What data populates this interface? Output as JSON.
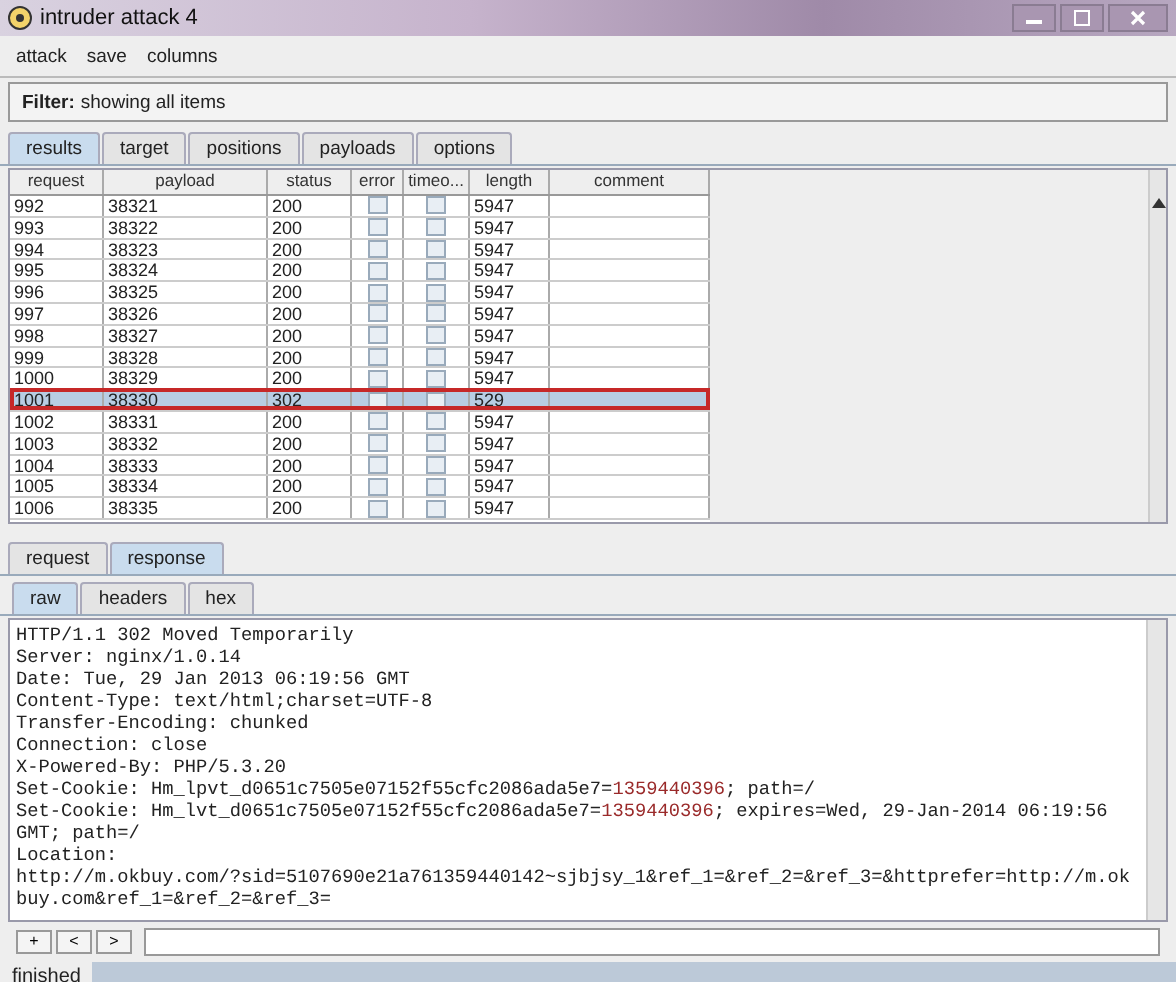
{
  "window": {
    "title": "intruder attack 4"
  },
  "menu": [
    "attack",
    "save",
    "columns"
  ],
  "filter": {
    "label": "Filter:",
    "text": "showing all items"
  },
  "tabs": [
    {
      "label": "results",
      "selected": true
    },
    {
      "label": "target",
      "selected": false
    },
    {
      "label": "positions",
      "selected": false
    },
    {
      "label": "payloads",
      "selected": false
    },
    {
      "label": "options",
      "selected": false
    }
  ],
  "table": {
    "columns": [
      "request",
      "payload",
      "status",
      "error",
      "timeo...",
      "length",
      "comment"
    ],
    "rows": [
      {
        "request": "992",
        "payload": "38321",
        "status": "200",
        "error": false,
        "timeout": false,
        "length": "5947",
        "selected": false,
        "outlined": false
      },
      {
        "request": "993",
        "payload": "38322",
        "status": "200",
        "error": false,
        "timeout": false,
        "length": "5947",
        "selected": false,
        "outlined": false
      },
      {
        "request": "994",
        "payload": "38323",
        "status": "200",
        "error": false,
        "timeout": false,
        "length": "5947",
        "selected": false,
        "outlined": false
      },
      {
        "request": "995",
        "payload": "38324",
        "status": "200",
        "error": false,
        "timeout": false,
        "length": "5947",
        "selected": false,
        "outlined": false
      },
      {
        "request": "996",
        "payload": "38325",
        "status": "200",
        "error": false,
        "timeout": false,
        "length": "5947",
        "selected": false,
        "outlined": false
      },
      {
        "request": "997",
        "payload": "38326",
        "status": "200",
        "error": false,
        "timeout": false,
        "length": "5947",
        "selected": false,
        "outlined": false
      },
      {
        "request": "998",
        "payload": "38327",
        "status": "200",
        "error": false,
        "timeout": false,
        "length": "5947",
        "selected": false,
        "outlined": false
      },
      {
        "request": "999",
        "payload": "38328",
        "status": "200",
        "error": false,
        "timeout": false,
        "length": "5947",
        "selected": false,
        "outlined": false
      },
      {
        "request": "1000",
        "payload": "38329",
        "status": "200",
        "error": false,
        "timeout": false,
        "length": "5947",
        "selected": false,
        "outlined": false
      },
      {
        "request": "1001",
        "payload": "38330",
        "status": "302",
        "error": false,
        "timeout": false,
        "length": "529",
        "selected": true,
        "outlined": true
      },
      {
        "request": "1002",
        "payload": "38331",
        "status": "200",
        "error": false,
        "timeout": false,
        "length": "5947",
        "selected": false,
        "outlined": false
      },
      {
        "request": "1003",
        "payload": "38332",
        "status": "200",
        "error": false,
        "timeout": false,
        "length": "5947",
        "selected": false,
        "outlined": false
      },
      {
        "request": "1004",
        "payload": "38333",
        "status": "200",
        "error": false,
        "timeout": false,
        "length": "5947",
        "selected": false,
        "outlined": false
      },
      {
        "request": "1005",
        "payload": "38334",
        "status": "200",
        "error": false,
        "timeout": false,
        "length": "5947",
        "selected": false,
        "outlined": false
      },
      {
        "request": "1006",
        "payload": "38335",
        "status": "200",
        "error": false,
        "timeout": false,
        "length": "5947",
        "selected": false,
        "outlined": false
      }
    ]
  },
  "message_tabs": [
    {
      "label": "request",
      "selected": false
    },
    {
      "label": "response",
      "selected": true
    }
  ],
  "view_tabs": [
    {
      "label": "raw",
      "selected": true
    },
    {
      "label": "headers",
      "selected": false
    },
    {
      "label": "hex",
      "selected": false
    }
  ],
  "response_lines": [
    [
      {
        "text": "HTTP/1.1 302 Moved Temporarily",
        "highlight": false
      }
    ],
    [
      {
        "text": "Server: nginx/1.0.14",
        "highlight": false
      }
    ],
    [
      {
        "text": "Date: Tue, 29 Jan 2013 06:19:56 GMT",
        "highlight": false
      }
    ],
    [
      {
        "text": "Content-Type: text/html;charset=UTF-8",
        "highlight": false
      }
    ],
    [
      {
        "text": "Transfer-Encoding: chunked",
        "highlight": false
      }
    ],
    [
      {
        "text": "Connection: close",
        "highlight": false
      }
    ],
    [
      {
        "text": "X-Powered-By: PHP/5.3.20",
        "highlight": false
      }
    ],
    [
      {
        "text": "Set-Cookie: Hm_lpvt_d0651c7505e07152f55cfc2086ada5e7=",
        "highlight": false
      },
      {
        "text": "1359440396",
        "highlight": true
      },
      {
        "text": "; path=/",
        "highlight": false
      }
    ],
    [
      {
        "text": "Set-Cookie: Hm_lvt_d0651c7505e07152f55cfc2086ada5e7=",
        "highlight": false
      },
      {
        "text": "1359440396",
        "highlight": true
      },
      {
        "text": "; expires=Wed, 29-Jan-2014 06:19:56",
        "highlight": false
      }
    ],
    [
      {
        "text": "GMT; path=/",
        "highlight": false
      }
    ],
    [
      {
        "text": "Location:",
        "highlight": false
      }
    ],
    [
      {
        "text": "http://m.okbuy.com/?sid=5107690e21a761359440142~sjbjsy_1&ref_1=&ref_2=&ref_3=&httprefer=http://m.ok",
        "highlight": false
      }
    ],
    [
      {
        "text": "buy.com&ref_1=&ref_2=&ref_3=",
        "highlight": false
      }
    ]
  ],
  "search_buttons": [
    "+",
    "<",
    ">"
  ],
  "status_bar": "finished"
}
